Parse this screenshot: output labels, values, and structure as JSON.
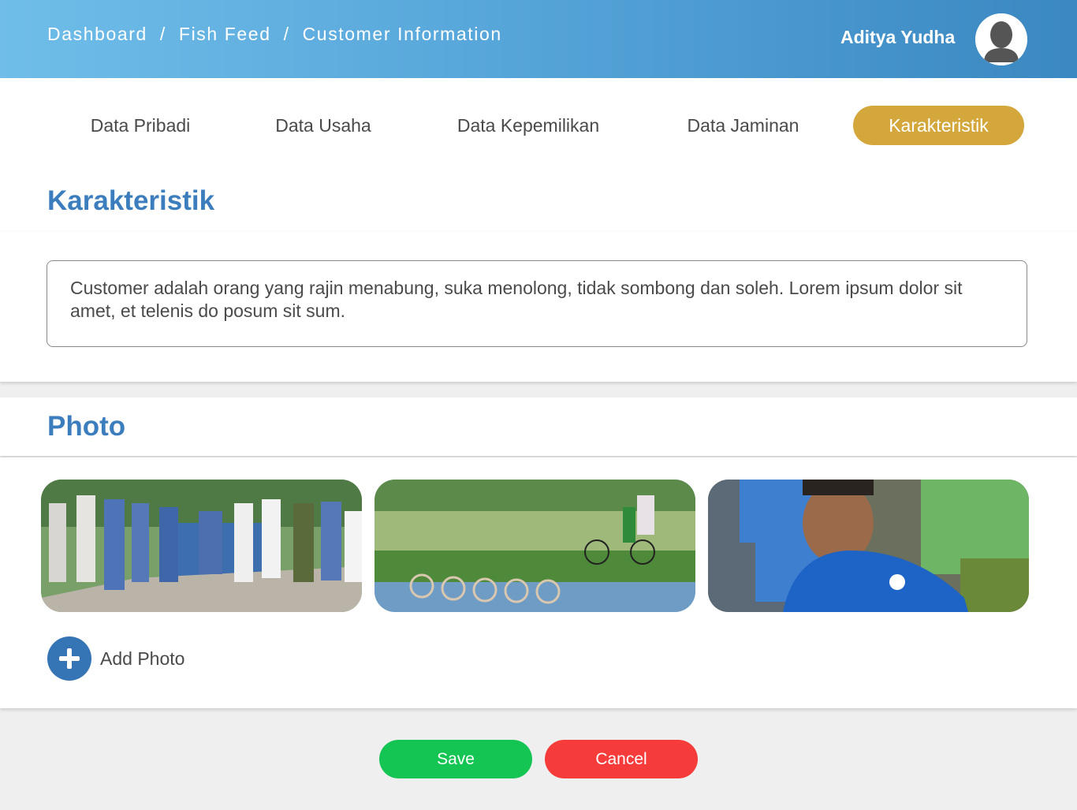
{
  "header": {
    "breadcrumb": [
      "Dashboard",
      "Fish Feed",
      "Customer Information"
    ],
    "separator": "/",
    "user_name": "Aditya Yudha",
    "avatar_icon": "user-avatar-icon"
  },
  "tabs": [
    {
      "label": "Data Pribadi",
      "active": false
    },
    {
      "label": "Data Usaha",
      "active": false
    },
    {
      "label": "Data Kepemilikan",
      "active": false
    },
    {
      "label": "Data Jaminan",
      "active": false
    },
    {
      "label": "Karakteristik",
      "active": true
    }
  ],
  "karakteristik": {
    "title": "Karakteristik",
    "description": "Customer adalah orang yang rajin menabung, suka menolong, tidak sombong dan soleh. Lorem ipsum dolor sit amet, et telenis do posum sit sum."
  },
  "photo": {
    "title": "Photo",
    "add_label": "Add Photo",
    "add_icon": "plus-circle-icon"
  },
  "actions": {
    "save_label": "Save",
    "cancel_label": "Cancel"
  },
  "colors": {
    "header_gradient_start": "#6fbde8",
    "header_gradient_end": "#3b88c2",
    "active_tab": "#d4a73c",
    "section_title": "#3b7dbd",
    "save": "#14c553",
    "cancel": "#f63b3b"
  }
}
